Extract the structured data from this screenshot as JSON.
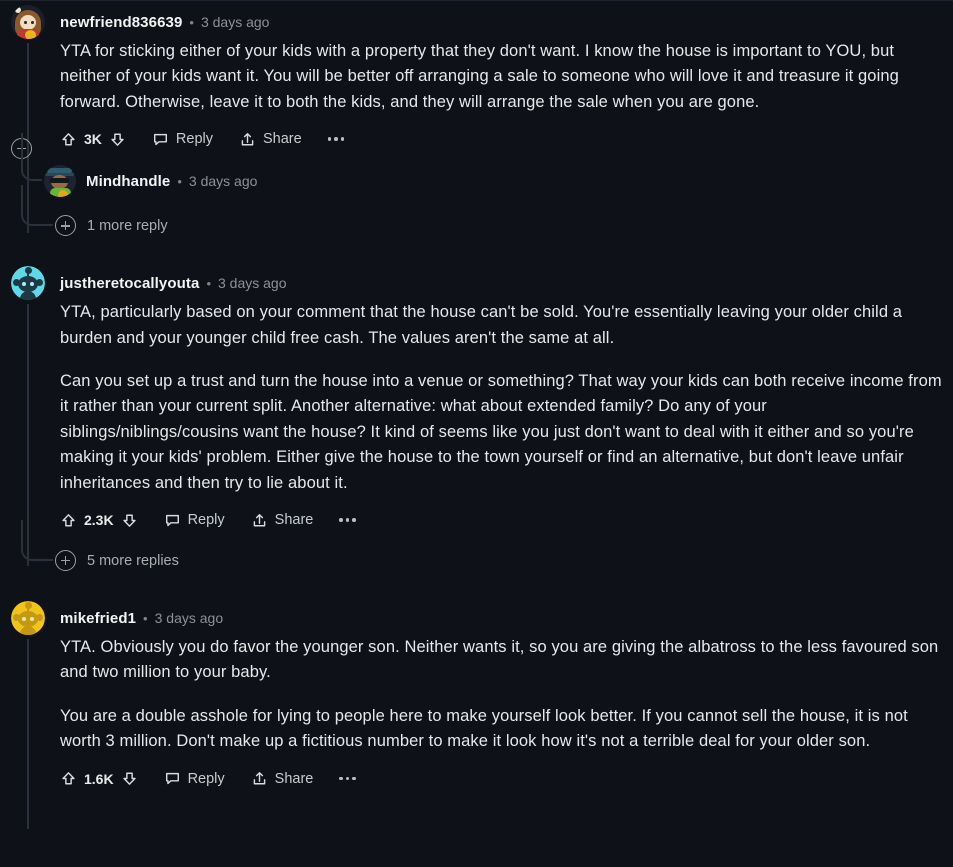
{
  "theme": {
    "background": "#0e1117",
    "text_primary": "#e6e9ea",
    "text_muted": "#8d9295",
    "thread_line": "#2a313d"
  },
  "comments": [
    {
      "id": "comment-1",
      "author": "newfriend836639",
      "separator": "•",
      "timestamp": "3 days ago",
      "avatar": "character-avatar",
      "paragraphs": [
        "YTA for sticking either of your kids with a property that they don't want. I know the house is important to YOU, but neither of your kids want it. You will be better off arranging a sale to someone who will love it and treasure it going forward. Otherwise, leave it to both the kids, and they will arrange the sale when you are gone."
      ],
      "actions": {
        "upvote_icon": "upvote-arrow-icon",
        "score": "3K",
        "downvote_icon": "downvote-arrow-icon",
        "reply_icon": "comment-bubble-icon",
        "reply_label": "Reply",
        "share_icon": "share-arrow-icon",
        "share_label": "Share",
        "overflow_icon": "more-options-icon"
      },
      "collapse_icon": "collapse-minus-icon",
      "replies": [
        {
          "id": "reply-1-1",
          "author": "Mindhandle",
          "separator": "•",
          "timestamp": "3 days ago",
          "avatar": "hat-sunglasses-avatar"
        }
      ],
      "more_replies": {
        "icon": "expand-plus-icon",
        "label": "1 more reply"
      }
    },
    {
      "id": "comment-2",
      "author": "justheretocallyouta",
      "separator": "•",
      "timestamp": "3 days ago",
      "avatar": "snoo-cyan-avatar",
      "paragraphs": [
        "YTA, particularly based on your comment that the house can't be sold. You're essentially leaving your older child a burden and your younger child free cash. The values aren't the same at all.",
        "Can you set up a trust and turn the house into a venue or something? That way your kids can both receive income from it rather than your current split. Another alternative: what about extended family? Do any of your siblings/niblings/cousins want the house? It kind of seems like you just don't want to deal with it either and so you're making it your kids' problem. Either give the house to the town yourself or find an alternative, but don't leave unfair inheritances and then try to lie about it."
      ],
      "actions": {
        "upvote_icon": "upvote-arrow-icon",
        "score": "2.3K",
        "downvote_icon": "downvote-arrow-icon",
        "reply_icon": "comment-bubble-icon",
        "reply_label": "Reply",
        "share_icon": "share-arrow-icon",
        "share_label": "Share",
        "overflow_icon": "more-options-icon"
      },
      "more_replies": {
        "icon": "expand-plus-icon",
        "label": "5 more replies"
      }
    },
    {
      "id": "comment-3",
      "author": "mikefried1",
      "separator": "•",
      "timestamp": "3 days ago",
      "avatar": "snoo-gold-avatar",
      "paragraphs": [
        "YTA. Obviously you do favor the younger son. Neither wants it, so you are giving the albatross to the less favoured son and two million to your baby.",
        "You are a double asshole for lying to people here to make yourself look better. If you cannot sell the house, it is not worth 3 million. Don't make up a fictitious number to make it look how it's not a terrible deal for your older son."
      ],
      "actions": {
        "upvote_icon": "upvote-arrow-icon",
        "score": "1.6K",
        "downvote_icon": "downvote-arrow-icon",
        "reply_icon": "comment-bubble-icon",
        "reply_label": "Reply",
        "share_icon": "share-arrow-icon",
        "share_label": "Share",
        "overflow_icon": "more-options-icon"
      }
    }
  ]
}
